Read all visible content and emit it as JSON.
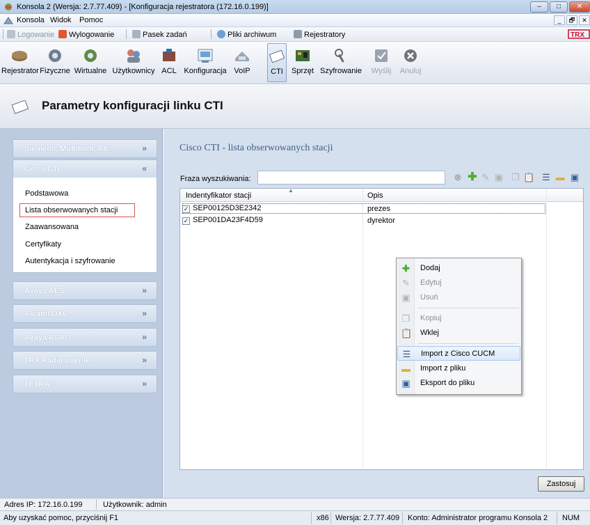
{
  "window": {
    "title": "Konsola 2 (Wersja: 2.7.77.409) - [Konfiguracja rejestratora (172.16.0.199)]",
    "minimize": "–",
    "maximize": "□",
    "close": "✕"
  },
  "menubar": {
    "items": [
      "Konsola",
      "Widok",
      "Pomoc"
    ],
    "mdi": [
      "_",
      "🗗",
      "✕"
    ]
  },
  "quick_toolbar": {
    "items": [
      {
        "label": "Logowanie",
        "disabled": true
      },
      {
        "label": "Wylogowanie",
        "disabled": false
      },
      {
        "label": "Pasek zadań",
        "disabled": false
      },
      {
        "label": "Pliki archiwum",
        "disabled": false
      },
      {
        "label": "Rejestratory",
        "disabled": false
      }
    ],
    "brand": "TRX"
  },
  "ribbon": {
    "buttons": [
      {
        "label": "Rejestrator",
        "icon": "recorder-icon",
        "active": false,
        "disabled": false
      },
      {
        "label": "Fizyczne",
        "icon": "physical-channel-icon",
        "active": false,
        "disabled": false
      },
      {
        "label": "Wirtualne",
        "icon": "virtual-channel-icon",
        "active": false,
        "disabled": false
      },
      {
        "label": "Użytkownicy",
        "icon": "users-icon",
        "active": false,
        "disabled": false
      },
      {
        "label": "ACL",
        "icon": "acl-icon",
        "active": false,
        "disabled": false
      },
      {
        "label": "Konfiguracja",
        "icon": "configuration-icon",
        "active": false,
        "disabled": false
      },
      {
        "label": "VoIP",
        "icon": "voip-phone-icon",
        "active": false,
        "disabled": false
      },
      {
        "label": "CTI",
        "icon": "cti-icon",
        "active": true,
        "disabled": false
      },
      {
        "label": "Sprzęt",
        "icon": "hardware-icon",
        "active": false,
        "disabled": false
      },
      {
        "label": "Szyfrowanie",
        "icon": "encryption-key-icon",
        "active": false,
        "disabled": false
      },
      {
        "label": "Wyślij",
        "icon": "send-check-icon",
        "active": false,
        "disabled": true
      },
      {
        "label": "Anuluj",
        "icon": "cancel-x-icon",
        "active": false,
        "disabled": true
      }
    ]
  },
  "header": {
    "title": "Parametry konfiguracji linku CTI"
  },
  "nav": {
    "sections": [
      {
        "label": "Siemens, Multikom, Alc...",
        "expanded": false
      },
      {
        "label": "Cisco CTI",
        "expanded": true
      },
      {
        "label": "Avaya AES",
        "expanded": false
      },
      {
        "label": "Alcatel OXE",
        "expanded": false
      },
      {
        "label": "Avaya ASAI",
        "expanded": false
      },
      {
        "label": "TRX Radio over IP",
        "expanded": false
      },
      {
        "label": "TETRA",
        "expanded": false
      }
    ],
    "cisco_items": [
      "Podstawowa",
      "Lista obserwowanych stacji",
      "Zaawansowana",
      "Certyfikaty",
      "Autentykacja i szyfrowanie"
    ],
    "selected_item": "Lista obserwowanych stacji"
  },
  "main": {
    "title": "Cisco CTI - lista obserwowanych stacji",
    "search_label": "Fraza wyszukiwania:",
    "search_value": "",
    "columns": [
      "Indentyfikator stacji",
      "Opis"
    ],
    "rows": [
      {
        "id": "SEP00125D3E2342",
        "desc": "prezes",
        "checked": true
      },
      {
        "id": "SEP001DA23F4D59",
        "desc": "dyrektor",
        "checked": true
      }
    ],
    "apply_label": "Zastosuj"
  },
  "context_menu": {
    "items": [
      {
        "label": "Dodaj",
        "icon": "add-plus-icon",
        "disabled": false
      },
      {
        "label": "Edytuj",
        "icon": "edit-pencil-icon",
        "disabled": true
      },
      {
        "label": "Usuń",
        "icon": "delete-trash-icon",
        "disabled": true
      },
      {
        "label": "Kopiuj",
        "icon": "copy-icon",
        "disabled": true
      },
      {
        "label": "Wklej",
        "icon": "paste-icon",
        "disabled": false
      },
      {
        "label": "Import z Cisco CUCM",
        "icon": "import-server-icon",
        "disabled": false,
        "highlighted": true
      },
      {
        "label": "Import z pliku",
        "icon": "folder-open-icon",
        "disabled": false
      },
      {
        "label": "Eksport do pliku",
        "icon": "save-disk-icon",
        "disabled": false
      }
    ]
  },
  "status": {
    "ip": "Adres IP: 172.16.0.199",
    "user": "Użytkownik: admin",
    "help": "Aby uzyskać pomoc, przyciśnij F1",
    "arch": "x86",
    "version": "Wersja: 2.7.77.409",
    "account": "Konto: Administrator programu Konsola 2",
    "num": "NUM"
  },
  "colors": {
    "accent": "#3e5f8a",
    "nav_bg": "#bccbe0",
    "main_bg": "#d5e0ee",
    "selection_border": "#d9534f",
    "brand_red": "#c8102e"
  }
}
